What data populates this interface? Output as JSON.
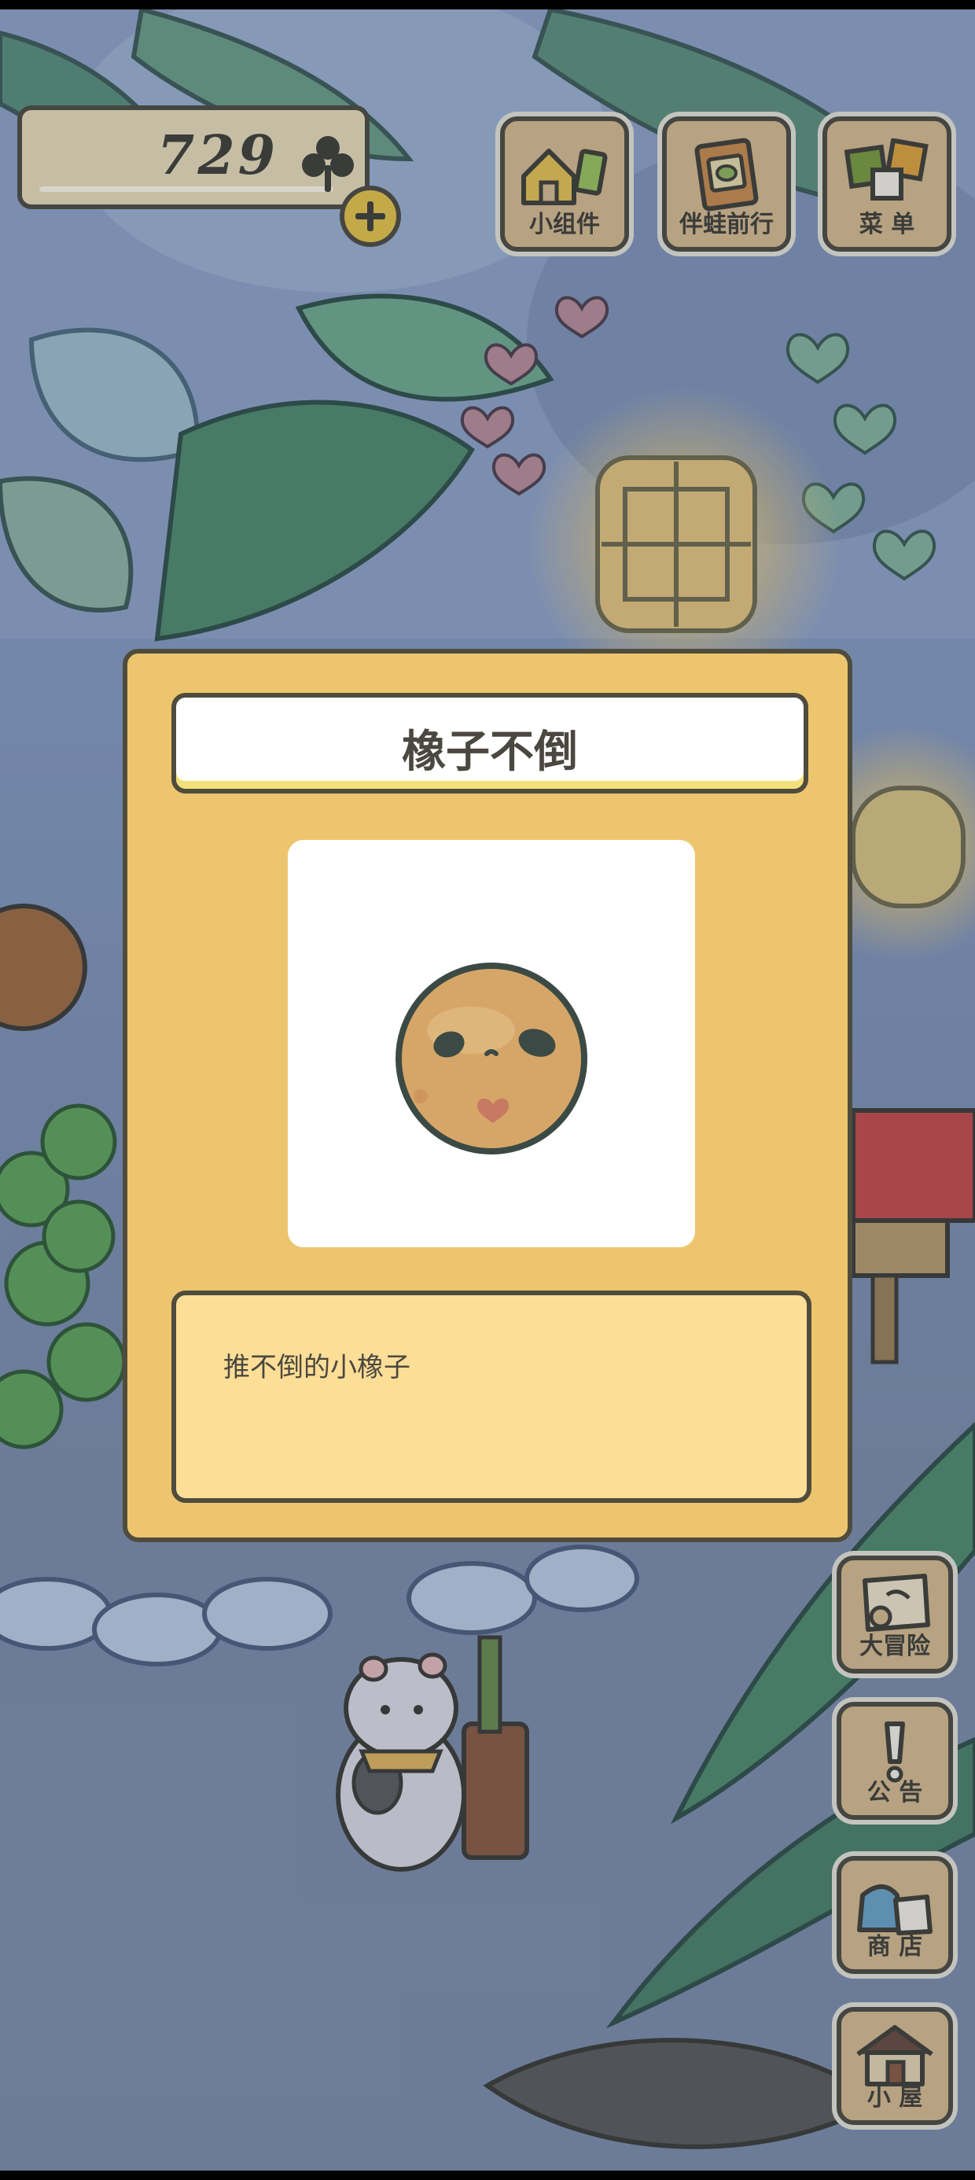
{
  "hud": {
    "clover_count": "729",
    "clover_icon": "clover-icon",
    "plus_icon": "plus-icon"
  },
  "top_menu": [
    {
      "label": "小组件",
      "icon": "house-widget-icon"
    },
    {
      "label": "伴蛙前行",
      "icon": "frog-book-icon"
    },
    {
      "label": "菜 单",
      "icon": "cards-menu-icon"
    }
  ],
  "side_menu": [
    {
      "label": "大冒险",
      "icon": "map-icon"
    },
    {
      "label": "公 告",
      "icon": "exclamation-icon"
    },
    {
      "label": "商 店",
      "icon": "shop-bags-icon"
    },
    {
      "label": "小 屋",
      "icon": "house-icon"
    }
  ],
  "item_dialog": {
    "title": "橡子不倒",
    "description": "推不倒的小橡子",
    "image_icon": "acorn-roly-poly-icon"
  },
  "colors": {
    "card_bg": "#edc56e",
    "desc_bg": "#fdde97",
    "outline": "#4f4c3d",
    "button_wood": "#d7ba8c",
    "coin_yellow": "#e7c246"
  }
}
